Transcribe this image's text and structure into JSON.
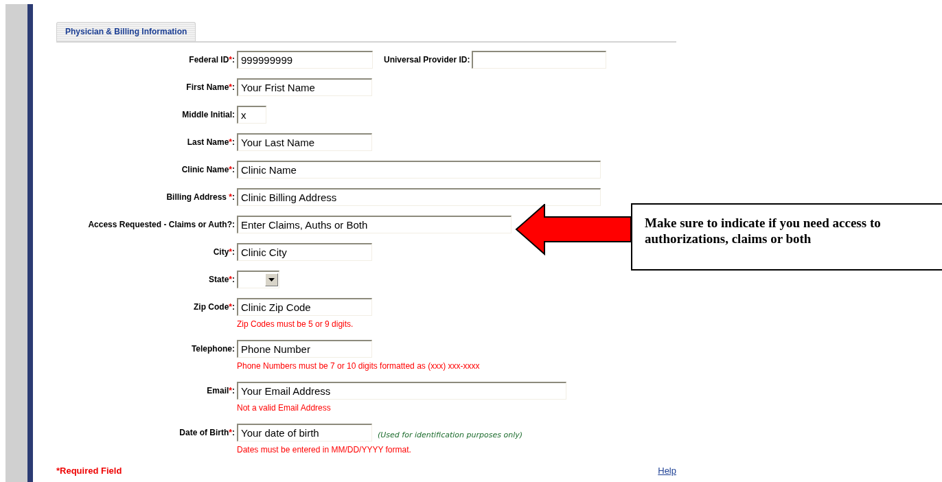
{
  "tab": {
    "label": "Physician & Billing Information",
    "selected": true
  },
  "rows": [
    {
      "fields": [
        {
          "kind": "text",
          "label": "Federal ID",
          "required_mark": "*",
          "label_end": ":",
          "value": "999999999"
        },
        {
          "kind": "text",
          "label": "Universal Provider ID",
          "label_end": ":"
        }
      ]
    },
    {
      "fields": [
        {
          "kind": "text",
          "label": "First Name",
          "required_mark": "*",
          "label_end": ":",
          "value": "Your Frist Name"
        }
      ]
    },
    {
      "fields": [
        {
          "kind": "text",
          "label": "Middle Initial",
          "label_end": ":",
          "value": "x"
        }
      ]
    },
    {
      "fields": [
        {
          "kind": "text",
          "label": "Last Name",
          "required_mark": "*",
          "label_end": ":",
          "value": "Your Last Name"
        }
      ]
    },
    {
      "fields": [
        {
          "kind": "text",
          "label": "Clinic Name",
          "required_mark": "*",
          "label_end": ":",
          "value": "Clinic Name"
        }
      ]
    },
    {
      "fields": [
        {
          "kind": "text",
          "label": "Billing Address ",
          "required_mark": "*",
          "label_end": ":",
          "value": "Clinic Billing Address"
        }
      ]
    },
    {
      "fields": [
        {
          "kind": "text",
          "label": "Access Requested - Claims or Auth?",
          "label_end": ":",
          "value": "Enter Claims, Auths or Both"
        }
      ]
    },
    {
      "fields": [
        {
          "kind": "text",
          "label": "City",
          "required_mark": "*",
          "label_end": ":",
          "value": "Clinic City"
        }
      ]
    },
    {
      "fields": [
        {
          "kind": "select",
          "label": "State",
          "required_mark": "*",
          "label_end": ":"
        }
      ]
    },
    {
      "fields": [
        {
          "kind": "text",
          "label": "Zip Code",
          "required_mark": "*",
          "label_end": ":",
          "value": "Clinic Zip Code",
          "error": "Zip Codes must be 5 or 9 digits."
        }
      ]
    },
    {
      "fields": [
        {
          "kind": "text",
          "label": "Telephone",
          "label_end": ":",
          "value": "Phone Number",
          "error": "Phone Numbers must be 7 or 10 digits formatted as (xxx) xxx-xxxx"
        }
      ]
    },
    {
      "fields": [
        {
          "kind": "text",
          "label": "Email",
          "required_mark": "*",
          "label_end": ":",
          "value": "Your Email Address",
          "error": "Not a valid Email Address"
        }
      ]
    },
    {
      "fields": [
        {
          "kind": "text",
          "label": "Date of Birth",
          "required_mark": "*",
          "label_end": ":",
          "value": "Your date of birth",
          "note": "(Used for identification purposes only)",
          "error": "Dates must be entered in MM/DD/YYYY format."
        }
      ]
    }
  ],
  "required_note": "*Required Field",
  "help_link": "Help",
  "callout": {
    "text": "Make sure to indicate if you need access to authorizations, claims or both"
  }
}
